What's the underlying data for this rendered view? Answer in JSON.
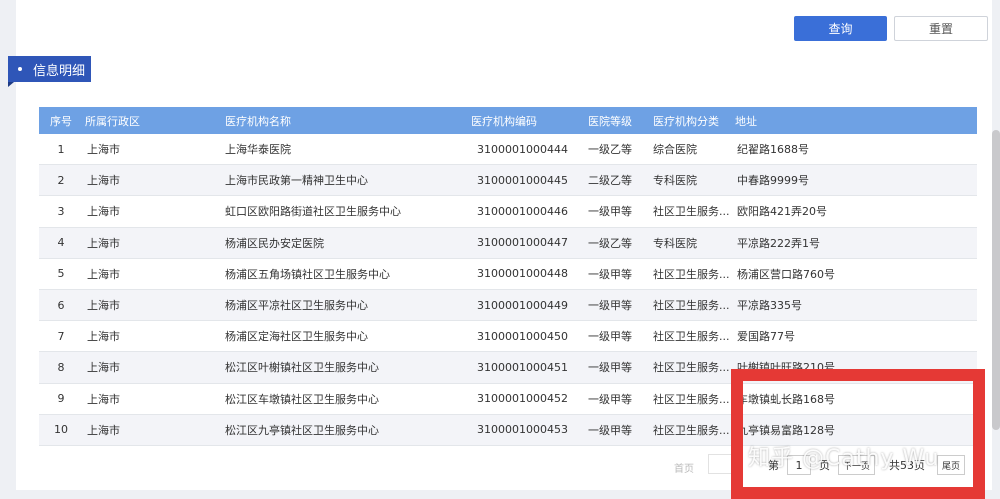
{
  "toolbar": {
    "query_label": "查询",
    "reset_label": "重置"
  },
  "section": {
    "title": "信息明细"
  },
  "table": {
    "headers": [
      "序号",
      "所属行政区",
      "医疗机构名称",
      "医疗机构编码",
      "医院等级",
      "医疗机构分类",
      "地址"
    ],
    "rows": [
      [
        "1",
        "上海市",
        "上海华泰医院",
        "3100001000444",
        "一级乙等",
        "综合医院",
        "纪翟路1688号"
      ],
      [
        "2",
        "上海市",
        "上海市民政第一精神卫生中心",
        "3100001000445",
        "二级乙等",
        "专科医院",
        "中春路9999号"
      ],
      [
        "3",
        "上海市",
        "虹口区欧阳路街道社区卫生服务中心",
        "3100001000446",
        "一级甲等",
        "社区卫生服务...",
        "欧阳路421弄20号"
      ],
      [
        "4",
        "上海市",
        "杨浦区民办安定医院",
        "3100001000447",
        "一级乙等",
        "专科医院",
        "平凉路222弄1号"
      ],
      [
        "5",
        "上海市",
        "杨浦区五角场镇社区卫生服务中心",
        "3100001000448",
        "一级甲等",
        "社区卫生服务...",
        "杨浦区营口路760号"
      ],
      [
        "6",
        "上海市",
        "杨浦区平凉社区卫生服务中心",
        "3100001000449",
        "一级甲等",
        "社区卫生服务...",
        "平凉路335号"
      ],
      [
        "7",
        "上海市",
        "杨浦区定海社区卫生服务中心",
        "3100001000450",
        "一级甲等",
        "社区卫生服务...",
        "爱国路77号"
      ],
      [
        "8",
        "上海市",
        "松江区叶榭镇社区卫生服务中心",
        "3100001000451",
        "一级甲等",
        "社区卫生服务...",
        "叶榭镇叶旺路210号"
      ],
      [
        "9",
        "上海市",
        "松江区车墩镇社区卫生服务中心",
        "3100001000452",
        "一级甲等",
        "社区卫生服务...",
        "车墩镇虬长路168号"
      ],
      [
        "10",
        "上海市",
        "松江区九亭镇社区卫生服务中心",
        "3100001000453",
        "一级甲等",
        "社区卫生服务...",
        "九亭镇易富路128号"
      ]
    ]
  },
  "pagination": {
    "first_label": "首页",
    "prefix": "第",
    "current_page": "1",
    "suffix": "页",
    "next_label": "下一页",
    "total_text": "共53页",
    "last_label": "尾页"
  },
  "watermark": {
    "text": "知乎 @Cathy Wu"
  },
  "colors": {
    "primary": "#3a6fd8",
    "header_bg": "#6ea1e4",
    "tag_bg": "#2f56b8",
    "highlight_frame": "#e53935"
  }
}
